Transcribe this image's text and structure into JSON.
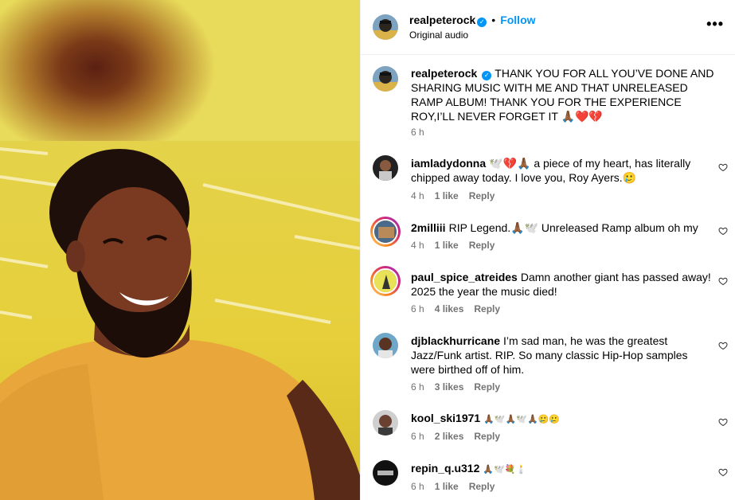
{
  "post": {
    "author": "realpeterock",
    "follow_label": "Follow",
    "separator": "•",
    "audio_label": "Original audio",
    "more_label": "•••"
  },
  "caption": {
    "author": "realpeterock",
    "text": "THANK YOU FOR ALL YOU’VE DONE AND SHARING MUSIC WITH ME AND THAT UNRELEASED RAMP ALBUM! THANK YOU FOR THE EXPERIENCE ROY,I’LL NEVER FORGET IT 🙏🏾❤️💔",
    "time": "6 h"
  },
  "comments": [
    {
      "author": "iamladydonna",
      "text": "🕊️💔🙏🏾 a piece of my heart, has literally chipped away today. I love you, Roy Ayers.🥲",
      "time": "4 h",
      "likes": "1 like",
      "reply": "Reply"
    },
    {
      "author": "2milliii",
      "text": "RIP Legend.🙏🏾🕊️ Unreleased Ramp album oh my",
      "time": "4 h",
      "likes": "1 like",
      "reply": "Reply"
    },
    {
      "author": "paul_spice_atreides",
      "text": "Damn another giant has passed away! 2025 the year the music died!",
      "time": "6 h",
      "likes": "4 likes",
      "reply": "Reply"
    },
    {
      "author": "djblackhurricane",
      "text": "I’m sad man, he was the greatest Jazz/Funk artist. RIP. So many classic Hip-Hop samples were birthed off of him.",
      "time": "6 h",
      "likes": "3 likes",
      "reply": "Reply"
    },
    {
      "author": "kool_ski1971",
      "text": "🙏🏾🕊️🙏🏾🕊️🙏🏾🥲🥲",
      "time": "6 h",
      "likes": "2 likes",
      "reply": "Reply"
    },
    {
      "author": "repin_q.u312",
      "text": "🙏🏾🕊️💐🕯️",
      "time": "6 h",
      "likes": "1 like",
      "reply": "Reply"
    }
  ],
  "colors": {
    "accent": "#0095f6",
    "meta": "#737373",
    "media_yellow": "#e6cf3a"
  },
  "icons": [
    "verified-badge-icon",
    "heart-outline-icon",
    "more-options-icon"
  ]
}
